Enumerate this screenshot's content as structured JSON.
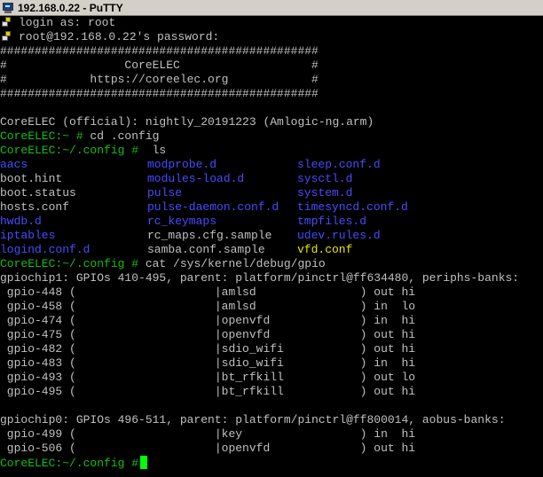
{
  "window": {
    "title": "192.168.0.22 - PuTTY"
  },
  "session": {
    "login_line": "login as: root",
    "password_line": "root@192.168.0.22's password:"
  },
  "banner": {
    "border": "##############################################",
    "line1": "#                 CoreELEC                   #",
    "line2": "#            https://coreelec.org            #"
  },
  "version_line": "CoreELEC (official): nightly_20191223 (Amlogic-ng.arm)",
  "prompts": {
    "home": "CoreELEC:~ #",
    "config": "CoreELEC:~/.config #"
  },
  "commands": {
    "cd": " cd .config",
    "ls": "  ls",
    "cat": " cat /sys/kernel/debug/gpio"
  },
  "ls_rows": [
    [
      {
        "t": "aacs",
        "c": "dir"
      },
      {
        "t": "modprobe.d",
        "c": "dir"
      },
      {
        "t": "sleep.conf.d",
        "c": "dir"
      }
    ],
    [
      {
        "t": "boot.hint",
        "c": "file"
      },
      {
        "t": "modules-load.d",
        "c": "dir"
      },
      {
        "t": "sysctl.d",
        "c": "dir"
      }
    ],
    [
      {
        "t": "boot.status",
        "c": "file"
      },
      {
        "t": "pulse",
        "c": "dir"
      },
      {
        "t": "system.d",
        "c": "dir"
      }
    ],
    [
      {
        "t": "hosts.conf",
        "c": "file"
      },
      {
        "t": "pulse-daemon.conf.d",
        "c": "dir"
      },
      {
        "t": "timesyncd.conf.d",
        "c": "dir"
      }
    ],
    [
      {
        "t": "hwdb.d",
        "c": "dir"
      },
      {
        "t": "rc_keymaps",
        "c": "dir"
      },
      {
        "t": "tmpfiles.d",
        "c": "dir"
      }
    ],
    [
      {
        "t": "iptables",
        "c": "dir"
      },
      {
        "t": "rc_maps.cfg.sample",
        "c": "file"
      },
      {
        "t": "udev.rules.d",
        "c": "dir"
      }
    ],
    [
      {
        "t": "logind.conf.d",
        "c": "dir"
      },
      {
        "t": "samba.conf.sample",
        "c": "file"
      },
      {
        "t": "vfd.conf",
        "c": "special"
      }
    ]
  ],
  "gpio_output": [
    "gpiochip1: GPIOs 410-495, parent: platform/pinctrl@ff634480, periphs-banks:",
    " gpio-448 (                    |amlsd               ) out hi",
    " gpio-458 (                    |amlsd               ) in  lo",
    " gpio-474 (                    |openvfd             ) in  hi",
    " gpio-475 (                    |openvfd             ) out hi",
    " gpio-482 (                    |sdio_wifi           ) out hi",
    " gpio-483 (                    |sdio_wifi           ) in  hi",
    " gpio-493 (                    |bt_rfkill           ) out lo",
    " gpio-495 (                    |bt_rfkill           ) out hi",
    "",
    "gpiochip0: GPIOs 496-511, parent: platform/pinctrl@ff800014, aobus-banks:",
    " gpio-499 (                    |key                 ) in  hi",
    " gpio-506 (                    |openvfd             ) out hi"
  ],
  "colors": {
    "background": "#000000",
    "text": "#c0c0c0",
    "prompt": "#13c013",
    "directory": "#4a4aff",
    "special_file": "#e8e800",
    "cursor": "#00ff00",
    "titlebar": "#d4d0c8"
  },
  "icons": {
    "title": "putty-monitor-icon",
    "login": "key-icon"
  }
}
